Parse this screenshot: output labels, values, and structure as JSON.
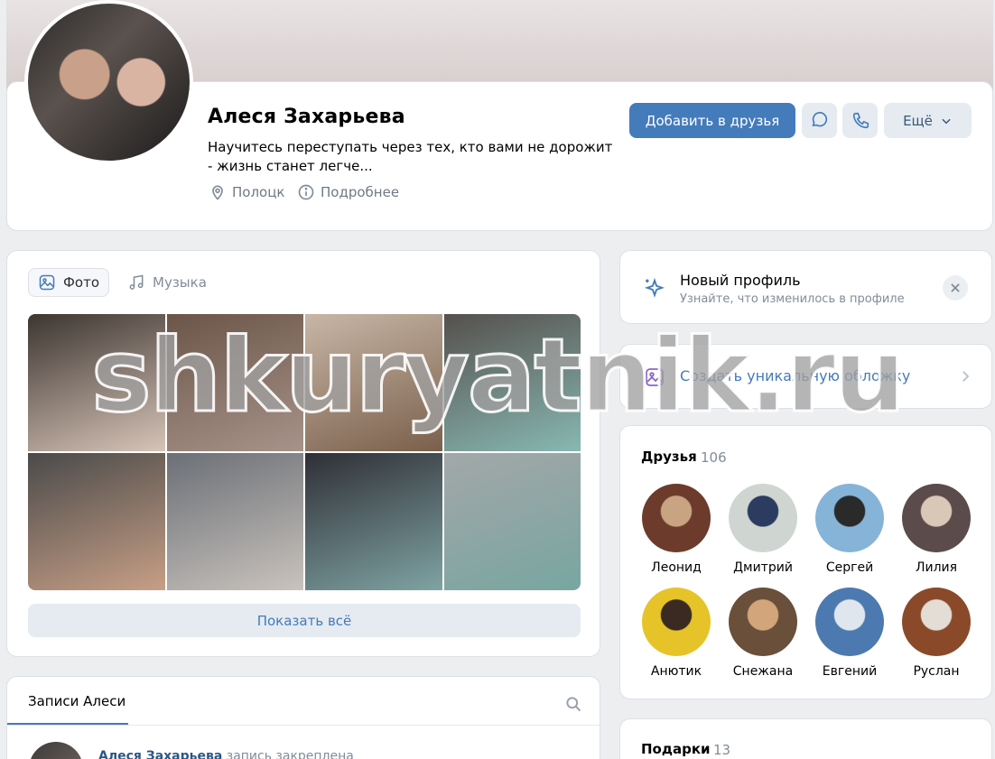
{
  "profile": {
    "name": "Алеся Захарьева",
    "status": "Научитесь переступать через тех, кто вами не дорожит - жизнь станет легче...",
    "city": "Полоцк",
    "details_label": "Подробнее"
  },
  "actions": {
    "add_friend": "Добавить в друзья",
    "more": "Ещё"
  },
  "media": {
    "tabs": [
      {
        "label": "Фото",
        "icon": "image-icon"
      },
      {
        "label": "Музыка",
        "icon": "music-note-icon"
      }
    ],
    "show_all": "Показать всё",
    "photo_colors": [
      [
        "#3c3530",
        "#d7c4b8"
      ],
      [
        "#6b5548",
        "#a8938a"
      ],
      [
        "#c8b6a6",
        "#7a604c"
      ],
      [
        "#55504d",
        "#88b8b2"
      ],
      [
        "#4a4a4a",
        "#c79f86"
      ],
      [
        "#6b6f76",
        "#c9c3bd"
      ],
      [
        "#2f2f36",
        "#7fa3a3"
      ],
      [
        "#a3a7a8",
        "#78a6a1"
      ]
    ]
  },
  "posts": {
    "tab_label": "Записи Алеси",
    "pinned_author": "Алеся Захарьева",
    "pinned_text": "запись закреплена"
  },
  "new_profile": {
    "title": "Новый профиль",
    "subtitle": "Узнайте, что изменилось в профиле"
  },
  "cover_action": {
    "label": "Создать уникальную обложку"
  },
  "friends": {
    "title": "Друзья",
    "count": "106",
    "list": [
      {
        "name": "Леонид",
        "colors": [
          "#6d3b2b",
          "#c9a483"
        ]
      },
      {
        "name": "Дмитрий",
        "colors": [
          "#cfd6d2",
          "#2c3c60"
        ]
      },
      {
        "name": "Сергей",
        "colors": [
          "#86b4d8",
          "#2a2a2a"
        ]
      },
      {
        "name": "Лилия",
        "colors": [
          "#5b4b4b",
          "#d9c7b7"
        ]
      },
      {
        "name": "Анютик",
        "colors": [
          "#e6c429",
          "#3a2a22"
        ]
      },
      {
        "name": "Снежана",
        "colors": [
          "#6a4f3a",
          "#d3a57b"
        ]
      },
      {
        "name": "Евгений",
        "colors": [
          "#4c7ab0",
          "#dfe6ee"
        ]
      },
      {
        "name": "Руслан",
        "colors": [
          "#8a4a2a",
          "#e4ddd5"
        ]
      }
    ]
  },
  "gifts": {
    "title": "Подарки",
    "count": "13"
  },
  "watermark": "shkuryatnik.ru",
  "colors": {
    "accent": "#447bba",
    "secondary_button": "#e5ebf1",
    "muted_text": "#818c99"
  }
}
